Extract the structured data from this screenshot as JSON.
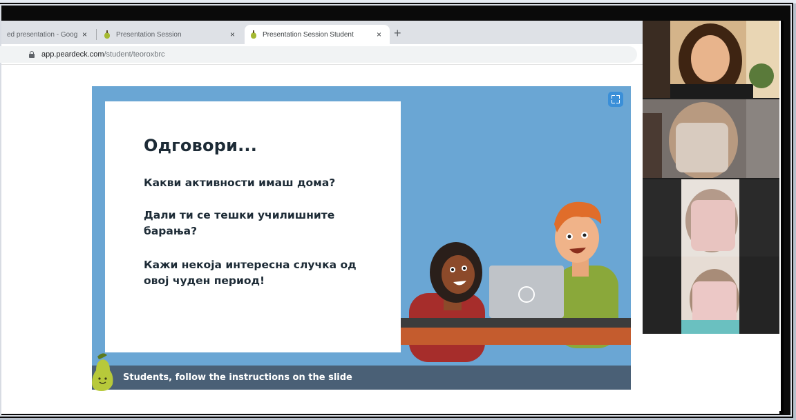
{
  "browser": {
    "tabs": [
      {
        "label": "ed presentation - Goog",
        "active": false
      },
      {
        "label": "Presentation Session",
        "active": false
      },
      {
        "label": "Presentation Session Student",
        "active": true
      }
    ],
    "close_glyph": "×",
    "new_tab_glyph": "+",
    "url_host": "app.peardeck.com",
    "url_path": "/student/teoroxbrc"
  },
  "slide": {
    "title": "Одговори...",
    "lines": [
      "Какви активности имаш дома?",
      "Дали ти се тешки училишните барања?",
      "Кажи некоја интересна случка од овој чуден период!"
    ],
    "instructions": "Students, follow the instructions on the slide"
  },
  "colors": {
    "slide_background": "#6aa6d4",
    "instructions_bar": "#4a6076",
    "fullscreen_button": "#3a8fd8",
    "pear": "#a5b931"
  },
  "icons": [
    "lock-icon",
    "pear-icon",
    "fullscreen-icon",
    "pear-mascot-icon",
    "close-icon",
    "plus-icon"
  ]
}
